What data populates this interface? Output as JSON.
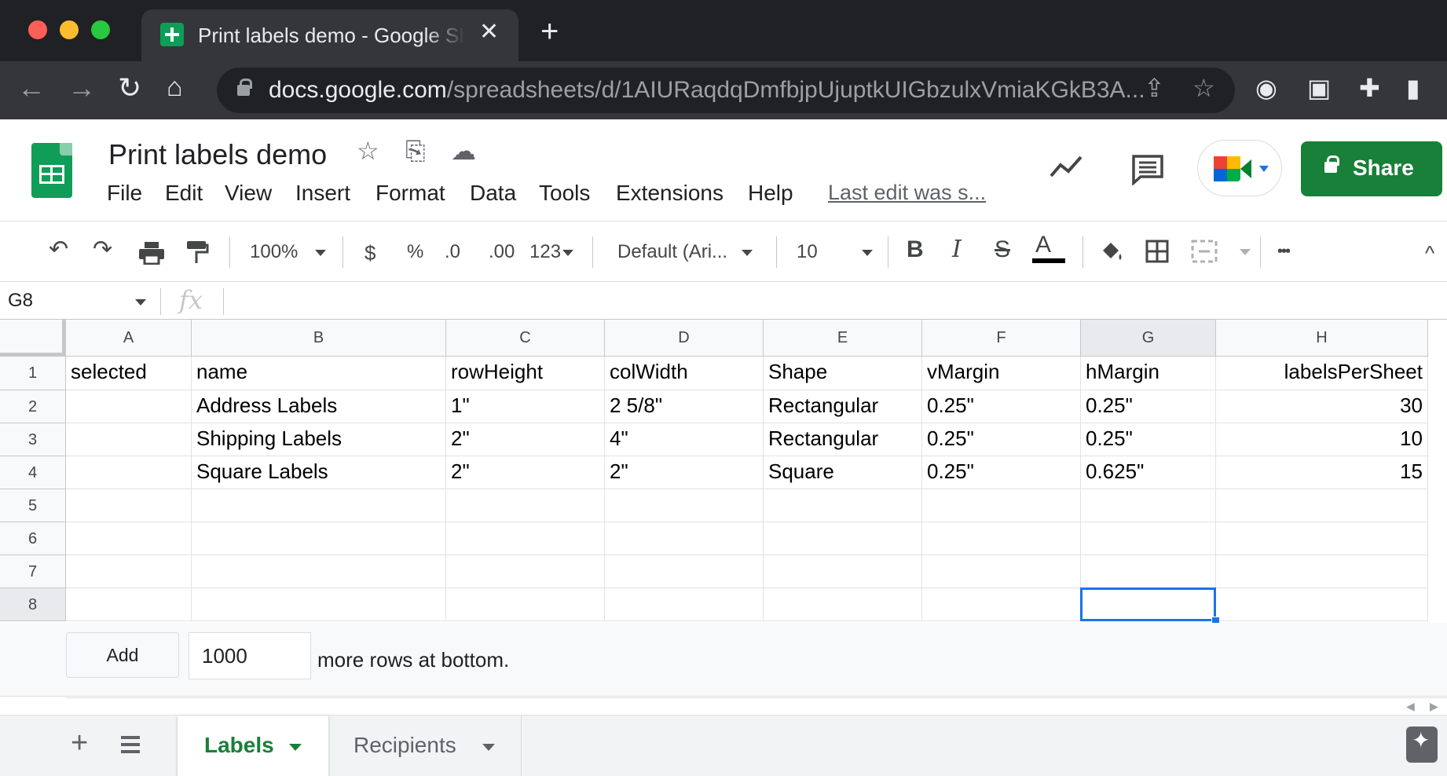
{
  "browser": {
    "tab_title": "Print labels demo - Google Sheets",
    "tab_close": "✕",
    "new_tab": "+",
    "url_host": "docs.google.com",
    "url_path": "/spreadsheets/d/1AIURaqdqDmfbjpUjuptkUIGbzulxVmiaKGkB3A..."
  },
  "doc": {
    "title": "Print labels demo",
    "menu": [
      "File",
      "Edit",
      "View",
      "Insert",
      "Format",
      "Data",
      "Tools",
      "Extensions",
      "Help"
    ],
    "last_edit": "Last edit was s...",
    "share_label": "Share"
  },
  "toolbar": {
    "zoom": "100%",
    "currency": "$",
    "percent": "%",
    "dec_decrease": ".0",
    "dec_increase": ".00",
    "more_formats": "123",
    "font": "Default (Ari...",
    "font_size": "10",
    "bold": "B",
    "italic": "I",
    "strike": "S",
    "text_color": "A",
    "more": "•••"
  },
  "formula_bar": {
    "cell_ref": "G8",
    "fx": "fx",
    "value": ""
  },
  "grid": {
    "columns": [
      "A",
      "B",
      "C",
      "D",
      "E",
      "F",
      "G",
      "H"
    ],
    "row_numbers": [
      "1",
      "2",
      "3",
      "4",
      "5",
      "6",
      "7",
      "8"
    ],
    "rows": [
      [
        "selected",
        "name",
        "rowHeight",
        "colWidth",
        "Shape",
        "vMargin",
        "hMargin",
        "labelsPerSheet"
      ],
      [
        "",
        "Address Labels",
        "1\"",
        "2 5/8\"",
        "Rectangular",
        "0.25\"",
        "0.25\"",
        "30"
      ],
      [
        "",
        "Shipping Labels",
        "2\"",
        "4\"",
        "Rectangular",
        "0.25\"",
        "0.25\"",
        "10"
      ],
      [
        "",
        "Square Labels",
        "2\"",
        "2\"",
        "Square",
        "0.25\"",
        "0.625\"",
        "15"
      ],
      [
        "",
        "",
        "",
        "",
        "",
        "",
        "",
        ""
      ],
      [
        "",
        "",
        "",
        "",
        "",
        "",
        "",
        ""
      ],
      [
        "",
        "",
        "",
        "",
        "",
        "",
        "",
        ""
      ],
      [
        "",
        "",
        "",
        "",
        "",
        "",
        "",
        ""
      ]
    ],
    "active_cell": "G8"
  },
  "add_rows": {
    "button": "Add",
    "count": "1000",
    "suffix": "more rows at bottom."
  },
  "sheets": {
    "tabs": [
      "Labels",
      "Recipients"
    ],
    "active": "Labels"
  },
  "colors": {
    "brand_green": "#188038",
    "selection_blue": "#1a73e8",
    "chrome_dark": "#202124"
  }
}
